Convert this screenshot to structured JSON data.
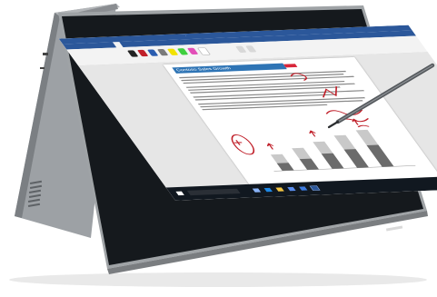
{
  "document": {
    "title": "Contoso Sales Growth"
  },
  "colors": {
    "laptop_shell": "#8c8f93",
    "word_blue": "#2b579a",
    "ink_red": "#c0202a",
    "taskbar": "#111820"
  },
  "icons": [
    "windows-start-icon",
    "search-icon",
    "task-view-icon",
    "edge-icon",
    "explorer-icon",
    "store-icon",
    "mail-icon",
    "word-icon",
    "pen-icon"
  ]
}
